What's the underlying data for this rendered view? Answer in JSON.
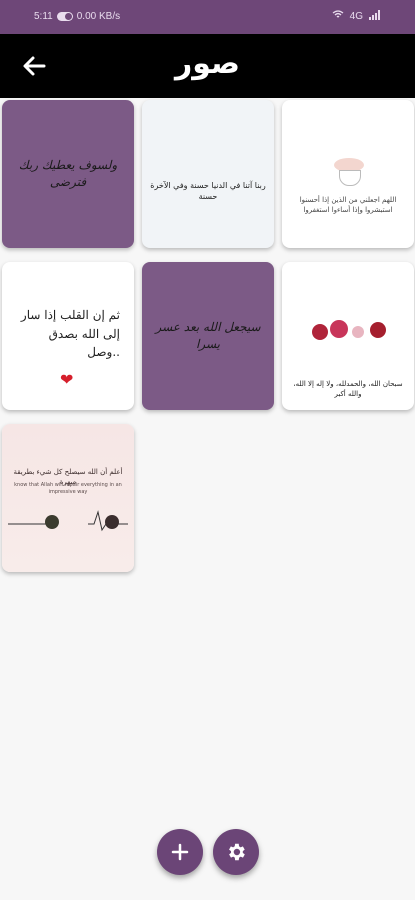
{
  "status_bar": {
    "time": "5:11",
    "network": "0.00 KB/s",
    "signal": "4G"
  },
  "app_bar": {
    "title": "صور",
    "back_icon": "arrow-back-icon"
  },
  "images": [
    {
      "style": "purple",
      "text": "ولسوف يعطيك ربك فترضى"
    },
    {
      "style": "light",
      "text": "ربنا آتنا في الدنيا حسنة وفي الآخرة حسنة"
    },
    {
      "style": "white",
      "text": "اللهم اجعلني من الذين إذا أحسنوا استبشروا وإذا أساءوا استغفروا"
    },
    {
      "style": "white",
      "text": "ثم إن القلب إذا سار إلى الله بصدق وصل.."
    },
    {
      "style": "purple",
      "text": "سيجعل الله بعد عسر يسرا"
    },
    {
      "style": "white",
      "text": "سبحان الله، والحمدلله، ولا إله إلا الله، والله أكبر"
    },
    {
      "style": "pink",
      "text": "أعلم أن الله سيصلح كل شيء بطريقة مبهرة",
      "subtext": "know that Allah will repair everything in an impressive way"
    }
  ],
  "actions": {
    "add_icon": "plus-icon",
    "settings_icon": "gear-icon"
  },
  "colors": {
    "status_bar": "#6e4778",
    "app_bar": "#000000",
    "fab": "#6b4577",
    "background": "#f7f7f7"
  }
}
